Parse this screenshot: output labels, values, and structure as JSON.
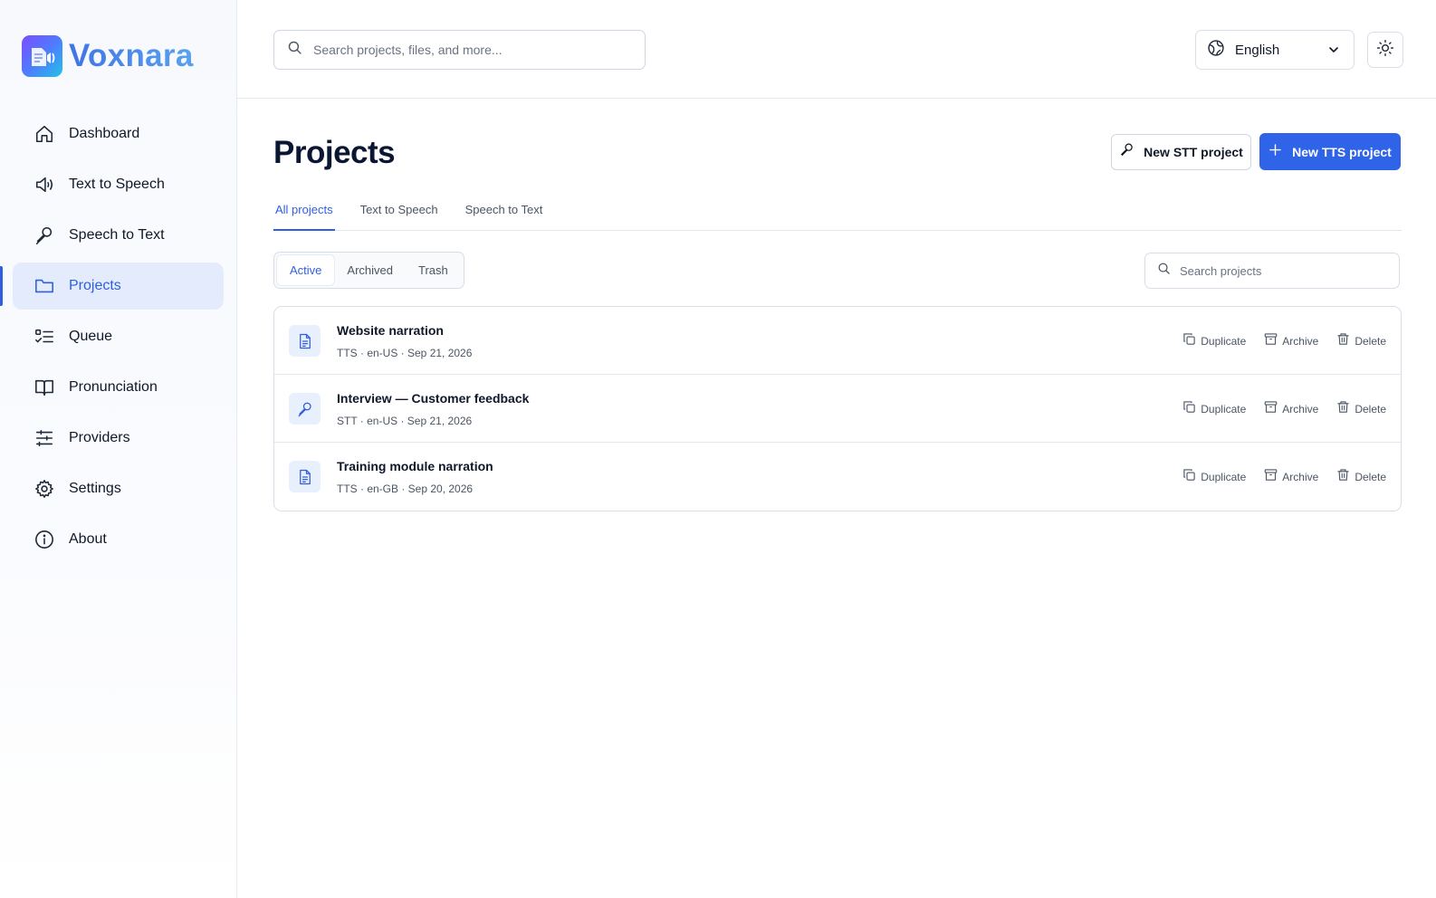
{
  "app": {
    "name": "Voxnara"
  },
  "sidebar": {
    "items": [
      {
        "label": "Dashboard",
        "icon": "home-icon",
        "active": false
      },
      {
        "label": "Text to Speech",
        "icon": "speaker-icon",
        "active": false
      },
      {
        "label": "Speech to Text",
        "icon": "microphone-icon",
        "active": false
      },
      {
        "label": "Projects",
        "icon": "folder-icon",
        "active": true
      },
      {
        "label": "Queue",
        "icon": "queue-icon",
        "active": false
      },
      {
        "label": "Pronunciation",
        "icon": "book-icon",
        "active": false
      },
      {
        "label": "Providers",
        "icon": "sliders-icon",
        "active": false
      },
      {
        "label": "Settings",
        "icon": "gear-icon",
        "active": false
      },
      {
        "label": "About",
        "icon": "info-icon",
        "active": false
      }
    ]
  },
  "topbar": {
    "search_placeholder": "Search projects, files, and more...",
    "language": "English"
  },
  "main": {
    "title": "Projects",
    "new_stt_label": "New STT project",
    "new_tts_label": "New TTS project",
    "tabs": [
      {
        "label": "All projects",
        "active": true
      },
      {
        "label": "Text to Speech",
        "active": false
      },
      {
        "label": "Speech to Text",
        "active": false
      }
    ],
    "filters": [
      {
        "label": "Active",
        "active": true
      },
      {
        "label": "Archived",
        "active": false
      },
      {
        "label": "Trash",
        "active": false
      }
    ],
    "search_placeholder": "Search projects",
    "actions": {
      "duplicate": "Duplicate",
      "archive": "Archive",
      "delete": "Delete"
    },
    "projects": [
      {
        "title": "Website narration",
        "meta": "TTS · en-US · Sep 21, 2026",
        "icon": "document-icon"
      },
      {
        "title": "Interview — Customer feedback",
        "meta": "STT · en-US · Sep 21, 2026",
        "icon": "microphone-icon"
      },
      {
        "title": "Training module narration",
        "meta": "TTS · en-GB · Sep 20, 2026",
        "icon": "document-icon"
      }
    ]
  },
  "colors": {
    "accent": "#2f63e8",
    "active_bg": "#e3ebfd",
    "border": "#d9dfe9"
  }
}
